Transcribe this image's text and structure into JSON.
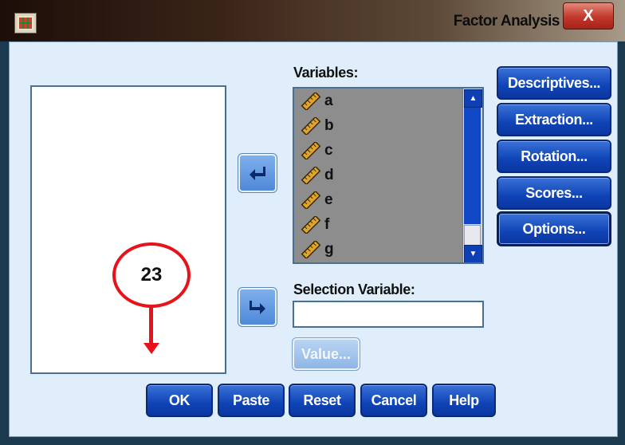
{
  "window": {
    "title": "Factor Analysis",
    "close_label": "X"
  },
  "variables": {
    "label": "Variables:",
    "items": [
      "a",
      "b",
      "c",
      "d",
      "e",
      "f",
      "g"
    ]
  },
  "selection": {
    "label": "Selection Variable:",
    "value": ""
  },
  "value_button": "Value...",
  "side_buttons": {
    "descriptives": "Descriptives...",
    "extraction": "Extraction...",
    "rotation": "Rotation...",
    "scores": "Scores...",
    "options": "Options..."
  },
  "bottom_buttons": {
    "ok": "OK",
    "paste": "Paste",
    "reset": "Reset",
    "cancel": "Cancel",
    "help": "Help"
  },
  "annotation": {
    "step_number": "23",
    "color": "#e8121a"
  },
  "colors": {
    "button_blue": "#0f43b6",
    "dialog_bg": "#dfeefa"
  }
}
